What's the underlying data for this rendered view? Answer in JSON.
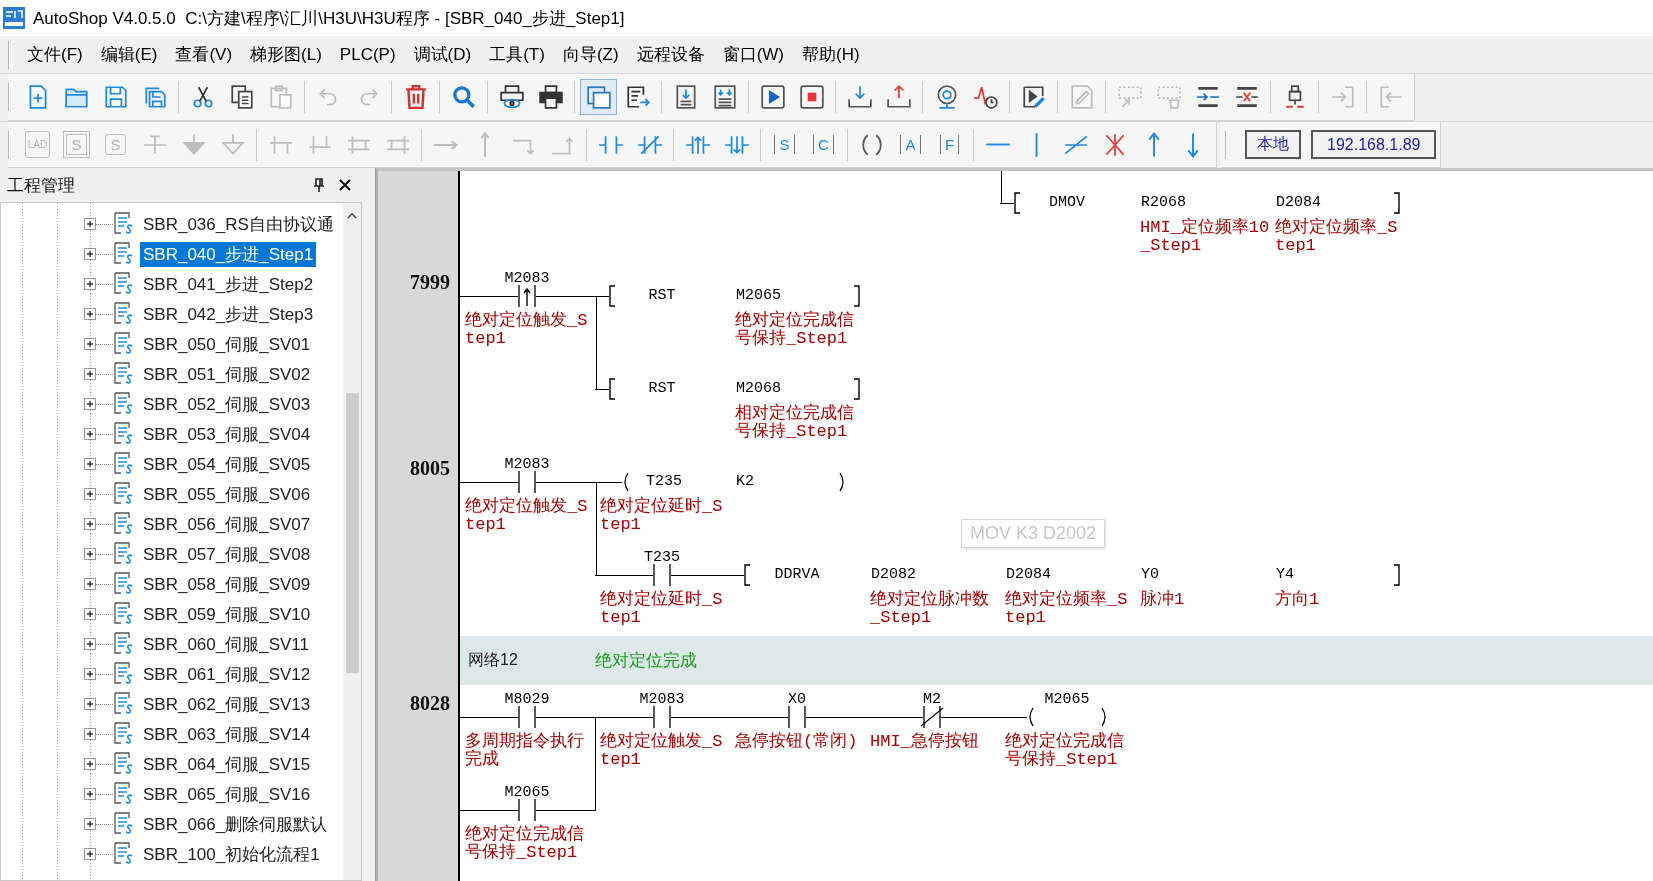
{
  "window": {
    "title": "AutoShop V4.0.5.0  C:\\方建\\程序\\汇川\\H3U\\H3U程序 - [SBR_040_步进_Step1]"
  },
  "menu": [
    "文件(F)",
    "编辑(E)",
    "查看(V)",
    "梯形图(L)",
    "PLC(P)",
    "调试(D)",
    "工具(T)",
    "向导(Z)",
    "远程设备",
    "窗口(W)",
    "帮助(H)"
  ],
  "toolbars": [
    {
      "groups": [
        [
          {
            "disabled": false,
            "on": false
          },
          {
            "disabled": false,
            "on": false
          },
          {
            "disabled": false,
            "on": false
          },
          {
            "disabled": false,
            "on": false
          }
        ],
        [
          {
            "disabled": false,
            "on": false
          },
          {
            "disabled": false,
            "on": false
          },
          {
            "disabled": true,
            "on": false
          }
        ],
        [
          {
            "disabled": true,
            "on": false
          },
          {
            "disabled": true,
            "on": false
          }
        ],
        [
          {
            "disabled": false,
            "on": false
          }
        ],
        [
          {
            "disabled": false,
            "on": false
          }
        ],
        [
          {
            "disabled": false,
            "on": false
          },
          {
            "disabled": false,
            "on": false
          }
        ],
        [
          {
            "disabled": false,
            "on": true
          },
          {
            "disabled": false,
            "on": false
          }
        ],
        [
          {
            "disabled": false,
            "on": false
          },
          {
            "disabled": false,
            "on": false
          }
        ],
        [
          {
            "disabled": false,
            "on": false
          },
          {
            "disabled": false,
            "on": false
          }
        ],
        [
          {
            "disabled": false,
            "on": false
          },
          {
            "disabled": false,
            "on": false
          }
        ],
        [
          {
            "disabled": false,
            "on": false
          },
          {
            "disabled": false,
            "on": false
          }
        ],
        [
          {
            "disabled": false,
            "on": false
          }
        ],
        [
          {
            "disabled": true,
            "on": false
          }
        ],
        [
          {
            "disabled": true,
            "on": false
          },
          {
            "disabled": true,
            "on": false
          },
          {
            "disabled": false,
            "on": false
          },
          {
            "disabled": false,
            "on": false
          }
        ],
        [
          {
            "disabled": false,
            "on": false
          }
        ],
        [
          {
            "disabled": true,
            "on": false
          }
        ],
        [
          {
            "disabled": true,
            "on": false
          }
        ]
      ]
    },
    {
      "groups": [
        [
          {
            "disabled": true,
            "label": "LAD"
          },
          {
            "disabled": true,
            "label": "S"
          },
          {
            "disabled": true,
            "label": "S"
          },
          {
            "disabled": true
          },
          {
            "disabled": true
          },
          {
            "disabled": true
          }
        ],
        [
          {
            "disabled": true
          },
          {
            "disabled": true
          },
          {
            "disabled": true
          },
          {
            "disabled": true
          }
        ],
        [
          {
            "disabled": true
          },
          {
            "disabled": true
          },
          {
            "disabled": true
          },
          {
            "disabled": true
          }
        ],
        [
          {
            "disabled": false
          },
          {
            "disabled": false
          }
        ],
        [
          {
            "disabled": false
          },
          {
            "disabled": false
          }
        ],
        [
          {
            "disabled": false,
            "label": "S"
          },
          {
            "disabled": false,
            "label": "C"
          }
        ],
        [
          {
            "disabled": false
          },
          {
            "disabled": false,
            "label": "A"
          },
          {
            "disabled": false,
            "label": "F"
          }
        ],
        [
          {
            "disabled": false
          },
          {
            "disabled": false
          },
          {
            "disabled": false
          },
          {
            "disabled": false
          },
          {
            "disabled": false
          },
          {
            "disabled": false
          }
        ]
      ]
    }
  ],
  "station_bar": {
    "mode": "本地",
    "address": "192.168.1.89"
  },
  "project_panel": {
    "title": "工程管理",
    "items": [
      {
        "label": "SBR_036_RS自由协议通",
        "expanded": false,
        "selected": false
      },
      {
        "label": "SBR_040_步进_Step1",
        "expanded": false,
        "selected": true
      },
      {
        "label": "SBR_041_步进_Step2",
        "expanded": false,
        "selected": false
      },
      {
        "label": "SBR_042_步进_Step3",
        "expanded": false,
        "selected": false
      },
      {
        "label": "SBR_050_伺服_SV01",
        "expanded": false,
        "selected": false
      },
      {
        "label": "SBR_051_伺服_SV02",
        "expanded": false,
        "selected": false
      },
      {
        "label": "SBR_052_伺服_SV03",
        "expanded": false,
        "selected": false
      },
      {
        "label": "SBR_053_伺服_SV04",
        "expanded": false,
        "selected": false
      },
      {
        "label": "SBR_054_伺服_SV05",
        "expanded": false,
        "selected": false
      },
      {
        "label": "SBR_055_伺服_SV06",
        "expanded": false,
        "selected": false
      },
      {
        "label": "SBR_056_伺服_SV07",
        "expanded": false,
        "selected": false
      },
      {
        "label": "SBR_057_伺服_SV08",
        "expanded": false,
        "selected": false
      },
      {
        "label": "SBR_058_伺服_SV09",
        "expanded": false,
        "selected": false
      },
      {
        "label": "SBR_059_伺服_SV10",
        "expanded": false,
        "selected": false
      },
      {
        "label": "SBR_060_伺服_SV11",
        "expanded": false,
        "selected": false
      },
      {
        "label": "SBR_061_伺服_SV12",
        "expanded": false,
        "selected": false
      },
      {
        "label": "SBR_062_伺服_SV13",
        "expanded": false,
        "selected": false
      },
      {
        "label": "SBR_063_伺服_SV14",
        "expanded": false,
        "selected": false
      },
      {
        "label": "SBR_064_伺服_SV15",
        "expanded": false,
        "selected": false
      },
      {
        "label": "SBR_065_伺服_SV16",
        "expanded": false,
        "selected": false
      },
      {
        "label": "SBR_066_删除伺服默认",
        "expanded": false,
        "selected": false
      },
      {
        "label": "SBR_100_初始化流程1",
        "expanded": false,
        "selected": false
      }
    ]
  },
  "ladder": {
    "tooltip": "MOV K3 D2002",
    "networks": [
      {
        "rows": [
          {
            "kind": "branch",
            "cells": [
              {
                "kind": "blank"
              },
              {
                "kind": "blank"
              },
              {
                "kind": "blank"
              },
              {
                "kind": "blank"
              },
              {
                "kind": "instruction",
                "opcode": "DMOV",
                "operands": [
                  {
                    "address": "R2068",
                    "comment": "HMI_定位频率10_Step1"
                  },
                  {
                    "address": "D2084",
                    "comment": "绝对定位频率_Step1"
                  }
                ]
              }
            ]
          }
        ]
      },
      {
        "step": "7999",
        "rows": [
          {
            "kind": "main",
            "cells": [
              {
                "kind": "rising",
                "address": "M2083",
                "comment": "绝对定位触发_Step1"
              },
              {
                "kind": "instruction",
                "opcode": "RST",
                "operands": [
                  {
                    "address": "M2065",
                    "comment": "绝对定位完成信号保持_Step1"
                  }
                ]
              }
            ]
          },
          {
            "kind": "branch",
            "cells": [
              {
                "kind": "blank"
              },
              {
                "kind": "instruction",
                "opcode": "RST",
                "operands": [
                  {
                    "address": "M2068",
                    "comment": "相对定位完成信号保持_Step1"
                  }
                ]
              }
            ]
          }
        ]
      },
      {
        "step": "8005",
        "rows": [
          {
            "kind": "main",
            "cells": [
              {
                "kind": "no",
                "address": "M2083",
                "comment": "绝对定位触发_Step1"
              },
              {
                "kind": "coil",
                "operands": [
                  {
                    "address": "T235",
                    "comment": "绝对定位延时_Step1"
                  },
                  {
                    "address": "K2"
                  }
                ]
              }
            ]
          },
          {
            "kind": "branch",
            "cells": [
              {
                "kind": "blank"
              },
              {
                "kind": "no",
                "address": "T235",
                "comment": "绝对定位延时_Step1"
              },
              {
                "kind": "instruction",
                "opcode": "DDRVA",
                "operands": [
                  {
                    "address": "D2082",
                    "comment": "绝对定位脉冲数_Step1"
                  },
                  {
                    "address": "D2084",
                    "comment": "绝对定位频率_Step1"
                  },
                  {
                    "address": "Y0",
                    "comment": "脉冲1"
                  },
                  {
                    "address": "Y4",
                    "comment": "方向1"
                  }
                ]
              }
            ]
          }
        ]
      },
      {
        "header": {
          "label": "网络12",
          "comment": "绝对定位完成"
        },
        "step": "8028",
        "rows": [
          {
            "kind": "main",
            "cells": [
              {
                "kind": "no",
                "address": "M8029",
                "comment": "多周期指令执行完成"
              },
              {
                "kind": "no",
                "address": "M2083",
                "comment": "绝对定位触发_Step1"
              },
              {
                "kind": "no",
                "address": "X0",
                "comment": "急停按钮(常闭)"
              },
              {
                "kind": "nc",
                "address": "M2",
                "comment": "HMI_急停按钮"
              },
              {
                "kind": "coil",
                "operands": [
                  {
                    "address": "M2065",
                    "comment": "绝对定位完成信号保持_Step1"
                  }
                ]
              }
            ]
          },
          {
            "kind": "parallel",
            "cells": [
              {
                "kind": "no",
                "address": "M2065",
                "comment": "绝对定位完成信号保持_Step1"
              }
            ]
          }
        ]
      }
    ]
  }
}
